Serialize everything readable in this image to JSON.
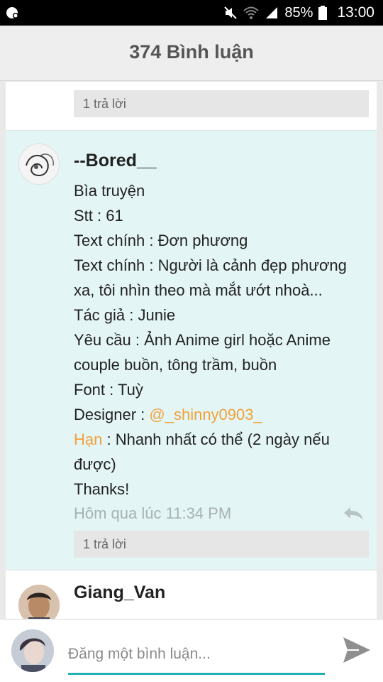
{
  "status_bar": {
    "battery": "85%",
    "time": "13:00"
  },
  "header": {
    "title": "374 Bình luận"
  },
  "comments": [
    {
      "replies_label": "1 trả lời"
    },
    {
      "username": "--Bored__",
      "lines": [
        "Bìa truyện",
        "Stt : 61",
        "Text chính : Đơn phương",
        "Text chính : Người là cảnh đẹp phương",
        "xa, tôi nhìn theo mà mắt ướt nhoà...",
        "Tác giả : Junie",
        "Yêu cầu : Ảnh Anime girl hoặc Anime",
        "couple buồn, tông trầm, buồn",
        "Font : Tuỳ"
      ],
      "designer_label": "Designer : ",
      "designer_mention": "@_shinny0903_",
      "deadline_label": "Hạn",
      "deadline_text": " : Nhanh nhất có thể (2 ngày nếu",
      "deadline_text_2": "được)",
      "thanks": "Thanks!",
      "timestamp": "Hôm qua lúc 11:34 PM",
      "replies_label": "1 trả lời"
    },
    {
      "username": "Giang_Van"
    }
  ],
  "composer": {
    "placeholder": "Đăng một bình luận..."
  },
  "colors": {
    "highlight": "#f0a23a",
    "accent": "#21b3b3",
    "selected_bg": "#e4f5f6"
  },
  "icons": [
    "notification-icon",
    "mute-icon",
    "wifi-icon",
    "signal-icon",
    "battery-icon",
    "reply-icon",
    "send-icon"
  ]
}
